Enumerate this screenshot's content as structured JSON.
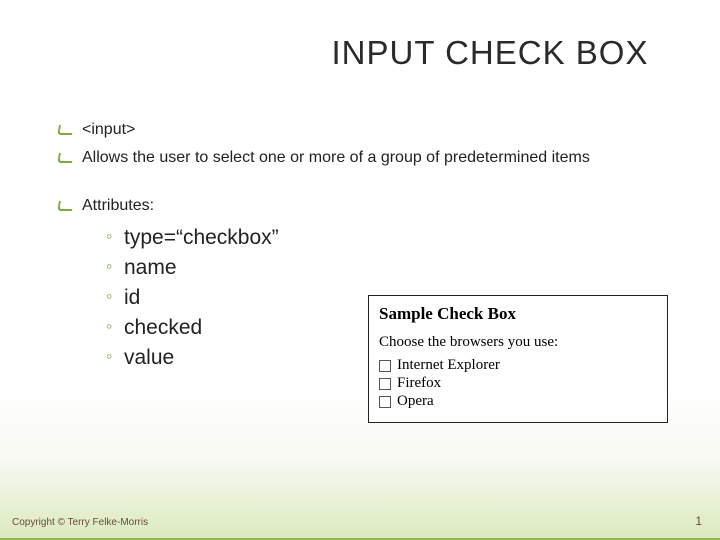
{
  "title": "INPUT CHECK BOX",
  "bullets": {
    "b0": "<input>",
    "b1": "Allows the user to select one or more of a group of predetermined items",
    "b2": "Attributes:"
  },
  "subs": {
    "s0": "type=“checkbox”",
    "s1": "name",
    "s2": "id",
    "s3": "checked",
    "s4": "value"
  },
  "sample": {
    "heading": "Sample Check Box",
    "prompt": "Choose the browsers you use:",
    "opts": {
      "o0": "Internet Explorer",
      "o1": "Firefox",
      "o2": "Opera"
    }
  },
  "footer": {
    "copyright": "Copyright © Terry Felke-Morris",
    "page": "1"
  }
}
